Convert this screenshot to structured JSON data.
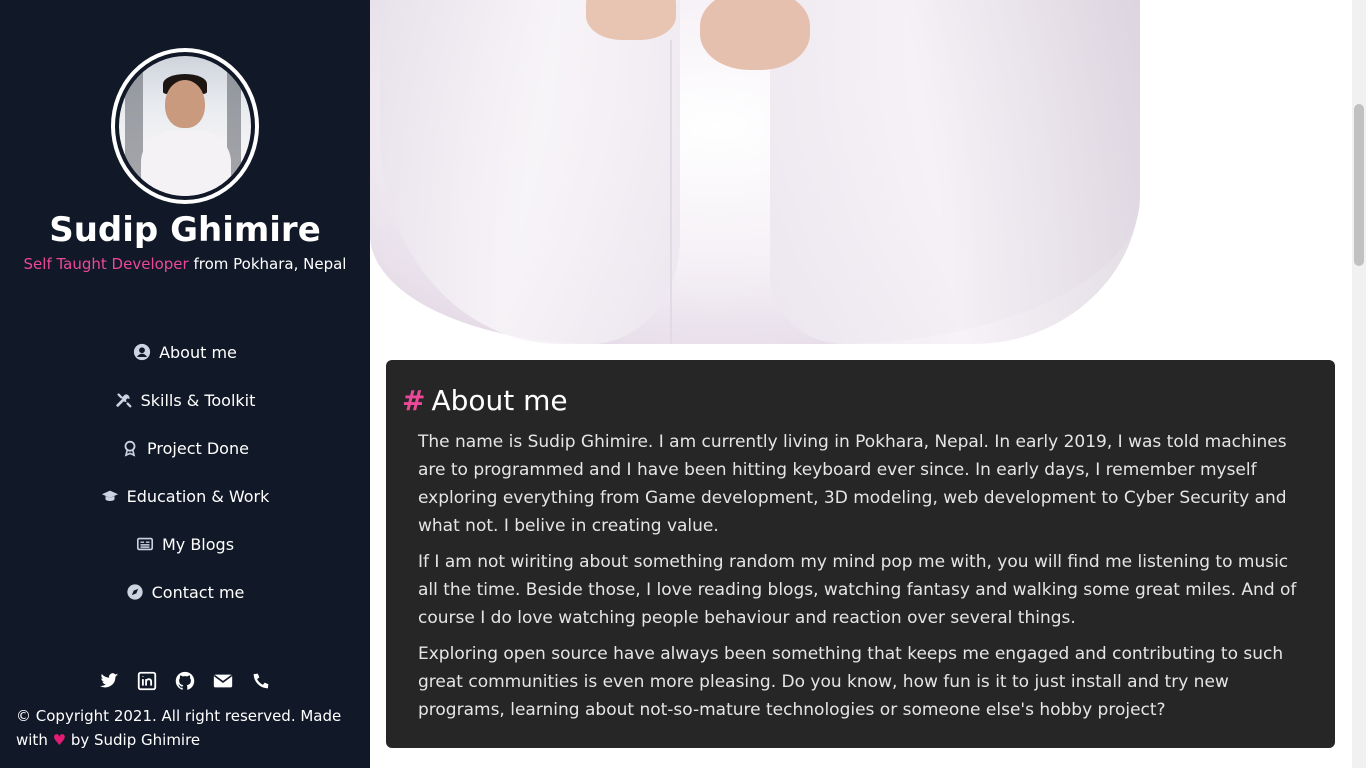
{
  "profile": {
    "name": "Sudip Ghimire",
    "tagline_accent": "Self Taught Developer",
    "tagline_rest": " from Pokhara, Nepal"
  },
  "nav": [
    {
      "label": "About me",
      "icon": "user-circle-icon"
    },
    {
      "label": "Skills & Toolkit",
      "icon": "tools-icon"
    },
    {
      "label": "Project Done",
      "icon": "award-icon"
    },
    {
      "label": "Education & Work",
      "icon": "graduation-cap-icon"
    },
    {
      "label": "My Blogs",
      "icon": "newspaper-icon"
    },
    {
      "label": "Contact me",
      "icon": "compass-icon"
    }
  ],
  "socials": [
    "twitter-icon",
    "linkedin-icon",
    "github-icon",
    "envelope-icon",
    "phone-icon"
  ],
  "footer": {
    "copyright_prefix": "© Copyright 2021. All right reserved. Made with",
    "copyright_suffix": "by Sudip Ghimire"
  },
  "about": {
    "heading_hash": "#",
    "heading": "About me",
    "paragraphs": [
      "The name is Sudip Ghimire. I am currently living in Pokhara, Nepal. In early 2019, I was told machines are to programmed and I have been hitting keyboard ever since. In early days, I remember myself exploring everything from Game development, 3D modeling, web development to Cyber Security and what not. I belive in creating value.",
      "If I am not wiriting about something random my mind pop me with, you will find me listening to music all the time. Beside those, I love reading blogs, watching fantasy and walking some great miles. And of course I do love watching people behaviour and reaction over several things.",
      "Exploring open source have always been something that keeps me engaged and contributing to such great communities is even more pleasing. Do you know, how fun is it to just install and try new programs, learning about not-so-mature technologies or someone else's hobby project?"
    ]
  },
  "colors": {
    "sidebar_bg": "#111827",
    "accent": "#ec4899",
    "card_bg": "#262626"
  }
}
